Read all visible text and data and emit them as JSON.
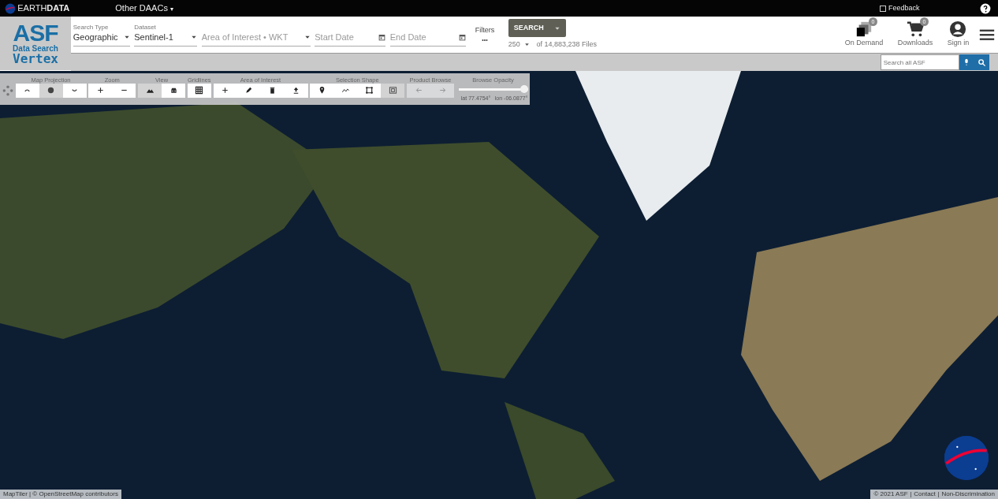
{
  "top_bar": {
    "brand": "EARTH**DATA**",
    "menu": "Other DAACs",
    "menu_caret": "▾",
    "feedback": "Feedback",
    "feedback_checked": false
  },
  "header": {
    "logo": {
      "title": "ASF",
      "subtitle": "Data Search",
      "product": "Vertex"
    },
    "fields": [
      {
        "label": "Search Type",
        "value": "Geographic",
        "kind": "select"
      },
      {
        "label": "Dataset",
        "value": "Sentinel-1",
        "kind": "select"
      },
      {
        "placeholder": "Area of Interest • WKT",
        "kind": "select"
      },
      {
        "placeholder": "Start Date",
        "kind": "date"
      },
      {
        "placeholder": "End Date",
        "kind": "date"
      }
    ],
    "filters": {
      "label": "Filters",
      "dots": "•••"
    },
    "search_button": "SEARCH",
    "max_results": "250",
    "file_count": "of 14,883,238 Files",
    "actions": [
      {
        "label": "On Demand",
        "badge": "0",
        "kind": "ondemand"
      },
      {
        "label": "Downloads",
        "badge": "0",
        "kind": "cart"
      },
      {
        "label": "Sign in",
        "kind": "user"
      }
    ],
    "site_search": {
      "placeholder": "Search all ASF"
    }
  },
  "toolbar": {
    "groups": [
      {
        "label": "Map Projection",
        "buttons": [
          {
            "selected": false,
            "disabled": false
          },
          {
            "selected": true,
            "disabled": false
          },
          {
            "selected": false,
            "disabled": false
          }
        ]
      },
      {
        "label": "Zoom",
        "buttons": [
          {
            "selected": false,
            "disabled": false
          },
          {
            "selected": false,
            "disabled": false
          }
        ]
      },
      {
        "label": "View",
        "buttons": [
          {
            "selected": true,
            "disabled": false
          },
          {
            "selected": false,
            "disabled": false
          }
        ]
      },
      {
        "label": "Gridlines",
        "buttons": [
          {
            "selected": false,
            "disabled": false
          }
        ]
      },
      {
        "label": "Area of Interest",
        "buttons": [
          {
            "selected": false,
            "disabled": false
          },
          {
            "selected": false,
            "disabled": false
          },
          {
            "selected": false,
            "disabled": false
          },
          {
            "selected": false,
            "disabled": false
          }
        ]
      },
      {
        "label": "Selection Shape",
        "buttons": [
          {
            "selected": false,
            "disabled": false
          },
          {
            "selected": false,
            "disabled": false
          },
          {
            "selected": false,
            "disabled": false
          },
          {
            "selected": true,
            "disabled": false
          }
        ]
      },
      {
        "label": "Product Browse",
        "buttons": [
          {
            "selected": false,
            "disabled": true
          },
          {
            "selected": false,
            "disabled": true
          }
        ]
      }
    ],
    "opacity": {
      "label": "Browse Opacity",
      "level": 0.95
    },
    "lat": "lat 77.4754°",
    "lon": "lon -06.0877°"
  },
  "map": {
    "attribution": "MapTiler | © OpenStreetMap contributors",
    "footer": [
      "© 2021 ASF",
      "Contact",
      "Non-Discrimination"
    ],
    "footer_separator": "|"
  }
}
